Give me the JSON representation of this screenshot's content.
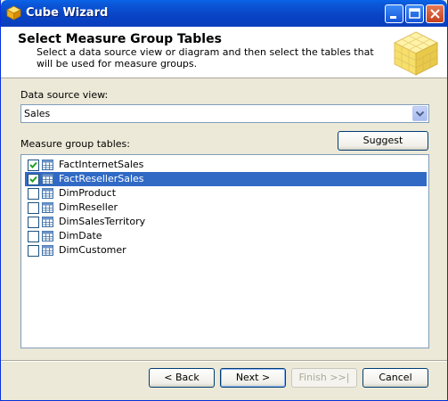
{
  "window": {
    "title": "Cube Wizard"
  },
  "header": {
    "title": "Select Measure Group Tables",
    "description": "Select a data source view or diagram and then select the tables that will be used for measure groups."
  },
  "data_source": {
    "label": "Data source view:",
    "value": "Sales"
  },
  "suggest_label": "Suggest",
  "tables": {
    "label": "Measure group tables:",
    "items": [
      {
        "name": "FactInternetSales",
        "checked": true,
        "selected": false
      },
      {
        "name": "FactResellerSales",
        "checked": true,
        "selected": true
      },
      {
        "name": "DimProduct",
        "checked": false,
        "selected": false
      },
      {
        "name": "DimReseller",
        "checked": false,
        "selected": false
      },
      {
        "name": "DimSalesTerritory",
        "checked": false,
        "selected": false
      },
      {
        "name": "DimDate",
        "checked": false,
        "selected": false
      },
      {
        "name": "DimCustomer",
        "checked": false,
        "selected": false
      }
    ]
  },
  "buttons": {
    "back": "< Back",
    "next": "Next >",
    "finish": "Finish >>|",
    "cancel": "Cancel"
  },
  "colors": {
    "selection": "#316ac5",
    "titlebar": "#0843c4"
  }
}
